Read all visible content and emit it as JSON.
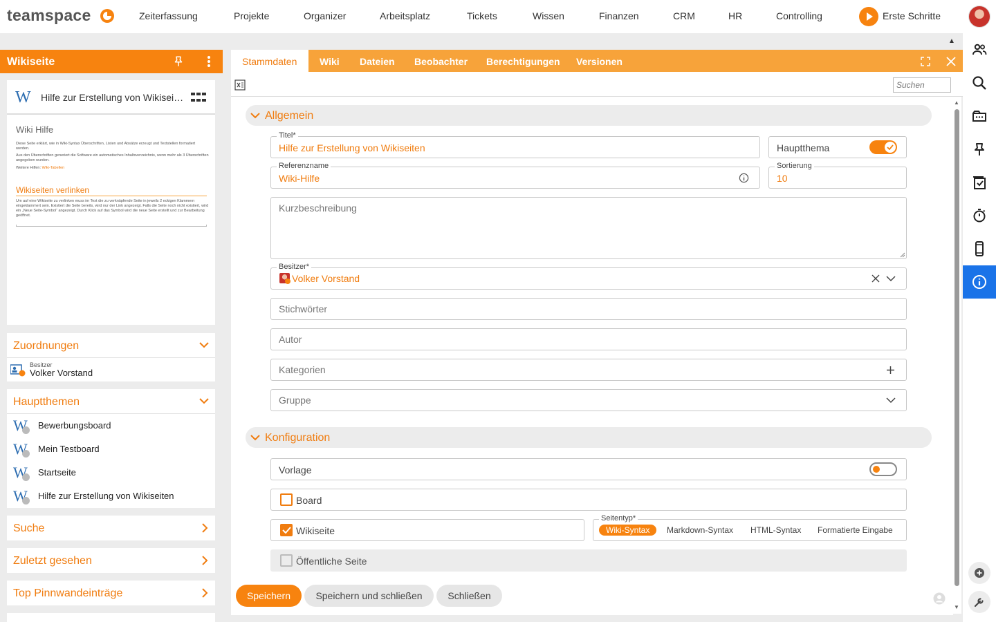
{
  "app": {
    "logo_text": "teamspace",
    "user": "Volker Vorstand"
  },
  "nav": {
    "items": [
      "Zeiterfassung",
      "Projekte",
      "Organizer",
      "Arbeitsplatz",
      "Tickets",
      "Wissen",
      "Finanzen",
      "CRM",
      "HR",
      "Controlling"
    ],
    "first_steps": "Erste Schritte"
  },
  "left": {
    "header_title": "Wikiseite",
    "doc_title": "Hilfe zur Erstellung von Wikisei…",
    "preview": {
      "heading": "Wiki Hilfe",
      "para1": "Diese Seite erklärt, wie in Wiki-Syntax Überschriften, Listen und Absätze erzeugt und Textstellen formatiert werden.",
      "para2": "Aus den Überschriften generiert die Software ein automatisches Inhaltsverzeichnis, wenn mehr als 3 Überschriften angegeben wurden.",
      "more_label": "Weitere Hilfen:",
      "more_link": "Wiki-Tabellen",
      "subheading": "Wikiseiten verlinken",
      "para3": "Um auf eine Wikiseite zu verlinken muss im Text die zu verknüpfende Seite in jeweils 2 eckigen Klammern eingeklammert sein. Existiert die Seite bereits, wird nur der Link angezeigt. Falls die Seite noch nicht existiert, wird ein „Neue Seite-Symbol“ angezeigt. Durch Klick auf das Symbol wird die neue Seite erstellt und zur Bearbeitung geöffnet."
    },
    "zuordnungen": {
      "title": "Zuordnungen",
      "owner_label": "Besitzer",
      "owner_value": "Volker Vorstand"
    },
    "hauptthemen": {
      "title": "Hauptthemen",
      "items": [
        "Bewerbungsboard",
        "Mein Testboard",
        "Startseite",
        "Hilfe zur Erstellung von Wikiseiten"
      ]
    },
    "suche": "Suche",
    "zuletzt": "Zuletzt gesehen",
    "pinnwand": "Top Pinnwandeinträge"
  },
  "tabs": [
    "Stammdaten",
    "Wiki",
    "Dateien",
    "Beobachter",
    "Berechtigungen",
    "Versionen"
  ],
  "toolbar": {
    "search_placeholder": "Suchen"
  },
  "form": {
    "allgemein_title": "Allgemein",
    "titel_label": "Titel*",
    "titel_value": "Hilfe zur Erstellung von Wikiseiten",
    "hauptthema_label": "Hauptthema",
    "referenz_label": "Referenzname",
    "referenz_value": "Wiki-Hilfe",
    "sortierung_label": "Sortierung",
    "sortierung_value": "10",
    "kurz_placeholder": "Kurzbeschreibung",
    "besitzer_label": "Besitzer*",
    "besitzer_value": "Volker Vorstand",
    "stichwoerter_placeholder": "Stichwörter",
    "autor_placeholder": "Autor",
    "kategorien_placeholder": "Kategorien",
    "gruppe_placeholder": "Gruppe",
    "konfiguration_title": "Konfiguration",
    "vorlage_label": "Vorlage",
    "board_label": "Board",
    "wikiseite_label": "Wikiseite",
    "seitentyp_label": "Seitentyp*",
    "seitentyp_options": [
      "Wiki-Syntax",
      "Markdown-Syntax",
      "HTML-Syntax",
      "Formatierte Eingabe"
    ],
    "oeffentlich_label": "Öffentliche Seite"
  },
  "actions": {
    "save": "Speichern",
    "save_close": "Speichern und schließen",
    "close": "Schließen"
  },
  "colors": {
    "accent": "#f7830f",
    "tab_bar": "#f7a33a",
    "info_active": "#1a73e8"
  }
}
